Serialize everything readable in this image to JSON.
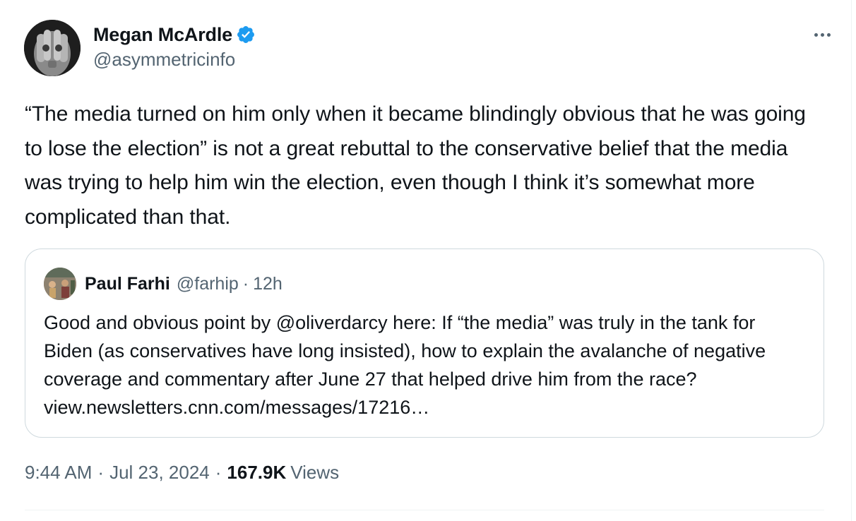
{
  "author": {
    "display_name": "Megan McArdle",
    "handle": "@asymmetricinfo",
    "verified_icon": "verified-badge-icon",
    "verified_color": "#1d9bf0"
  },
  "tweet": {
    "text": "“The media turned on him only when it became blindingly obvious that he was going to lose the election” is not a great rebuttal to the conservative belief that the media was trying to help him win the election, even though I think it’s somewhat more complicated than that."
  },
  "quoted_tweet": {
    "display_name": "Paul Farhi",
    "handle": "@farhip",
    "separator": "·",
    "time": "12h",
    "text": "Good and obvious point by @oliverdarcy here: If “the media” was truly in the tank for Biden (as conservatives have long insisted), how to explain the avalanche of negative coverage and commentary after June 27 that helped drive him from the race?  view.newsletters.cnn.com/messages/17216…"
  },
  "meta": {
    "time": "9:44 AM",
    "separator": "·",
    "date": "Jul 23, 2024",
    "views_count": "167.9K",
    "views_label": "Views"
  },
  "colors": {
    "text_primary": "#0f1419",
    "text_secondary": "#536471",
    "border": "#cfd9de"
  }
}
